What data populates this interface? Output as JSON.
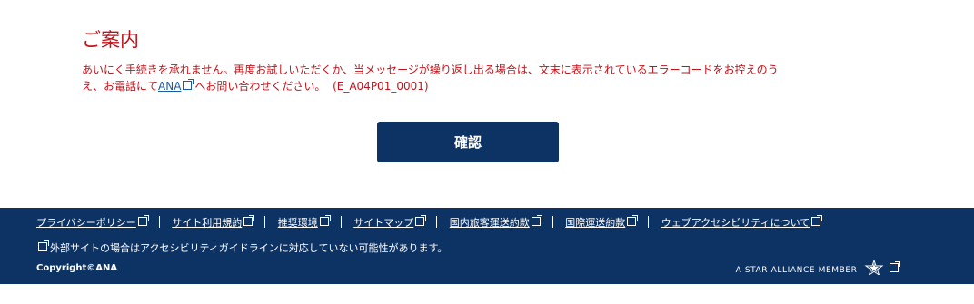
{
  "notice": {
    "title": "ご案内",
    "message_part1": "あいにく手続きを承れません。再度お試しいただくか、当メッセージが繰り返し出る場合は、文末に表示されているエラーコードをお控えのう",
    "message_part2": "え、お電話にて",
    "link_label": "ANA",
    "message_part3": "へお問い合わせください。",
    "error_code": "(E_A04P01_0001)"
  },
  "confirm_button": {
    "label": "確認"
  },
  "footer": {
    "links": [
      {
        "label": "プライバシーポリシー"
      },
      {
        "label": "サイト利用規約"
      },
      {
        "label": "推奨環境"
      },
      {
        "label": "サイトマップ"
      },
      {
        "label": "国内旅客運送約款"
      },
      {
        "label": "国際運送約款"
      },
      {
        "label": "ウェブアクセシビリティについて"
      }
    ],
    "note": "外部サイトの場合はアクセシビリティガイドラインに対応していない可能性があります。",
    "copyright": "Copyright©ANA",
    "alliance": "A STAR ALLIANCE MEMBER"
  },
  "colors": {
    "error": "#c0131a",
    "brand": "#0d3364",
    "link": "#1a5aa6"
  }
}
